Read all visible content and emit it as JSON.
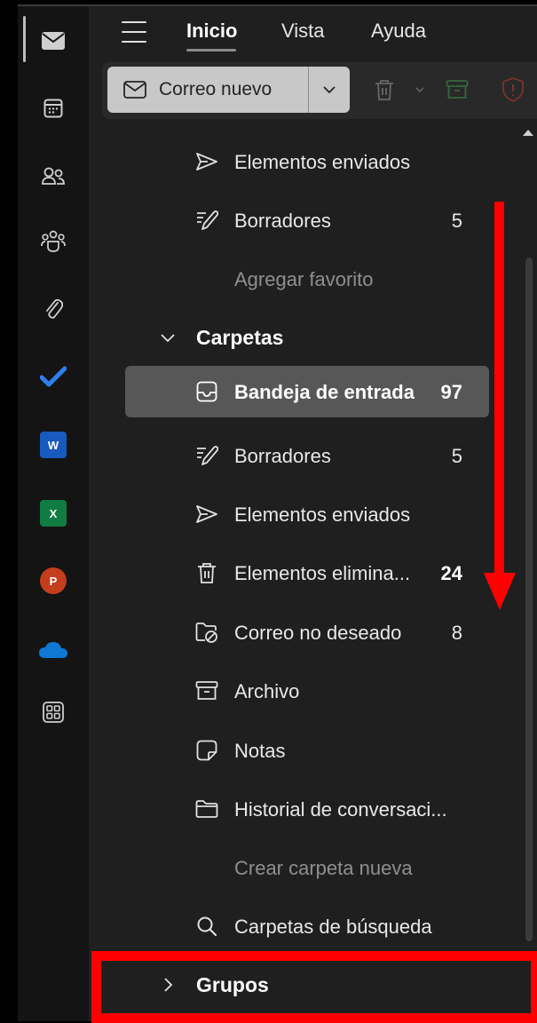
{
  "header": {
    "tabs": [
      {
        "label": "Inicio",
        "active": true
      },
      {
        "label": "Vista",
        "active": false
      },
      {
        "label": "Ayuda",
        "active": false
      }
    ]
  },
  "toolbar": {
    "new_mail_label": "Correo nuevo"
  },
  "rail": {
    "items": [
      "mail-icon",
      "calendar-icon",
      "people-icon",
      "groups-icon",
      "attachment-icon",
      "todo-icon",
      "word-icon",
      "excel-icon",
      "powerpoint-icon",
      "onedrive-icon",
      "apps-icon"
    ],
    "app_letters": {
      "word": "W",
      "excel": "X",
      "powerpoint": "P"
    }
  },
  "favorites": [
    {
      "label": "Elementos enviados",
      "icon": "send-icon",
      "count": ""
    },
    {
      "label": "Borradores",
      "icon": "draft-icon",
      "count": "5"
    },
    {
      "label": "Agregar favorito",
      "icon": "",
      "count": ""
    }
  ],
  "folders_section": {
    "label": "Carpetas",
    "expanded": true
  },
  "folders": [
    {
      "label": "Bandeja de entrada",
      "icon": "inbox-icon",
      "count": "97"
    },
    {
      "label": "Borradores",
      "icon": "draft-icon",
      "count": "5"
    },
    {
      "label": "Elementos enviados",
      "icon": "send-icon",
      "count": ""
    },
    {
      "label": "Elementos elimina...",
      "icon": "trash-icon",
      "count": "24"
    },
    {
      "label": "Correo no deseado",
      "icon": "junk-icon",
      "count": "8"
    },
    {
      "label": "Archivo",
      "icon": "archive-icon",
      "count": ""
    },
    {
      "label": "Notas",
      "icon": "note-icon",
      "count": ""
    },
    {
      "label": "Historial de conversaci...",
      "icon": "folder-icon",
      "count": ""
    },
    {
      "label": "Crear carpeta nueva",
      "icon": "",
      "count": ""
    },
    {
      "label": "Carpetas de búsqueda",
      "icon": "search-icon",
      "count": ""
    }
  ],
  "groups_section": {
    "label": "Grupos",
    "expanded": false
  },
  "colors": {
    "background": "#1f1f1f",
    "rail": "#141414",
    "selected_row": "#575757",
    "annotation": "#ff0000",
    "word": "#185abd",
    "excel": "#107c41",
    "powerpoint": "#c43e1c",
    "onedrive": "#0f78d4",
    "todo": "#2564cf"
  }
}
